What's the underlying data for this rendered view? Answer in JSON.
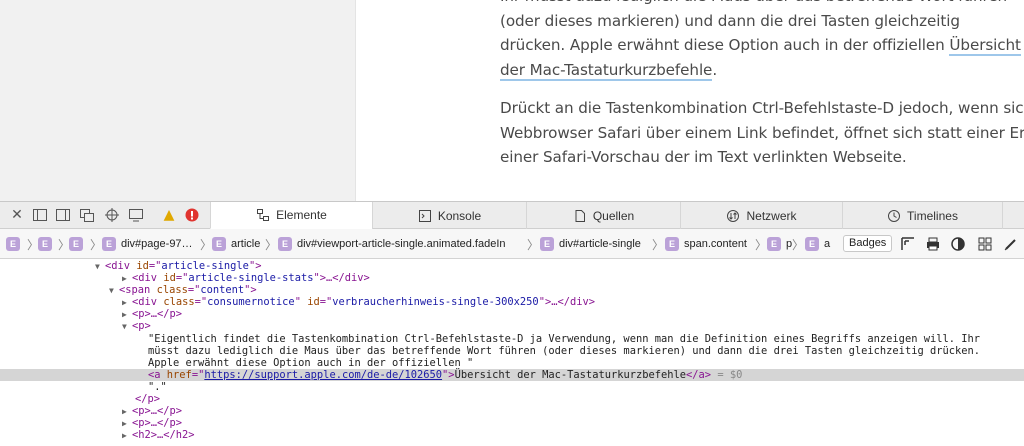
{
  "article": {
    "p1_lines": [
      "Ihr müsst dazu lediglich die Maus über das betreffende Wort führen",
      "(oder dieses markieren) und dann die drei Tasten gleichzeitig",
      "drücken. Apple erwähnt diese Option auch in der offiziellen "
    ],
    "p1_link_part1": "Übersicht",
    "p1_link_part2": "der Mac-Tastaturkurzbefehle",
    "p1_end": ".",
    "p2_lines": [
      "Drückt an die Tastenkombination Ctrl-Befehlstaste-D jedoch, wenn sich die",
      "Webbrowser Safari über einem Link befindet, öffnet sich statt einer Erklärung",
      "einer Safari-Vorschau der im Text verlinkten Webseite."
    ]
  },
  "devtools": {
    "tabs": [
      {
        "label": "Elemente",
        "icon": "elements-icon"
      },
      {
        "label": "Konsole",
        "icon": "console-icon"
      },
      {
        "label": "Quellen",
        "icon": "sources-icon"
      },
      {
        "label": "Netzwerk",
        "icon": "network-icon"
      },
      {
        "label": "Timelines",
        "icon": "timelines-icon"
      }
    ],
    "active_tab": "Elemente",
    "breadcrumb": [
      {
        "label": ""
      },
      {
        "label": ""
      },
      {
        "label": ""
      },
      {
        "label": "div#page-97…"
      },
      {
        "label": "article"
      },
      {
        "label": "div#viewport-article-single.animated.fadeIn"
      },
      {
        "label": "div#article-single"
      },
      {
        "label": "span.content"
      },
      {
        "label": "p"
      },
      {
        "label": "a"
      }
    ],
    "element_badge": "E",
    "badges_label": "Badges",
    "tree": {
      "r0": {
        "tag": "div",
        "attr": "id",
        "val": "article-single"
      },
      "r1": {
        "tag": "div",
        "attr": "id",
        "val": "article-single-stats",
        "tail": "…</div>"
      },
      "r2": {
        "tag": "span",
        "attr": "class",
        "val": "content"
      },
      "r3": {
        "tag": "div",
        "attr1": "class",
        "val1": "consumernotice",
        "attr2": "id",
        "val2": "verbraucherhinweis-single-300x250",
        "tail": "…</div>"
      },
      "r4": "<p>…</p>",
      "r5": "<p>",
      "text_lines": [
        "\"Eigentlich findet die Tastenkombination Ctrl-Befehlstaste-D ja Verwendung, wenn man die Definition eines Begriffs anzeigen will. Ihr",
        "müsst dazu lediglich die Maus über das betreffende Wort führen (oder dieses markieren) und dann die drei Tasten gleichzeitig drücken.",
        "Apple erwähnt diese Option auch in der offiziellen \""
      ],
      "sel_href": "https://support.apple.com/de-de/102650",
      "sel_text": "Übersicht der Mac-Tastaturkurzbefehle",
      "sel_suffix": "= $0",
      "dot": "\".\"",
      "close_p": "</p>",
      "r_p1": "<p>…</p>",
      "r_p2": "<p>…</p>",
      "r_h2": "<h2>…</h2>"
    }
  }
}
